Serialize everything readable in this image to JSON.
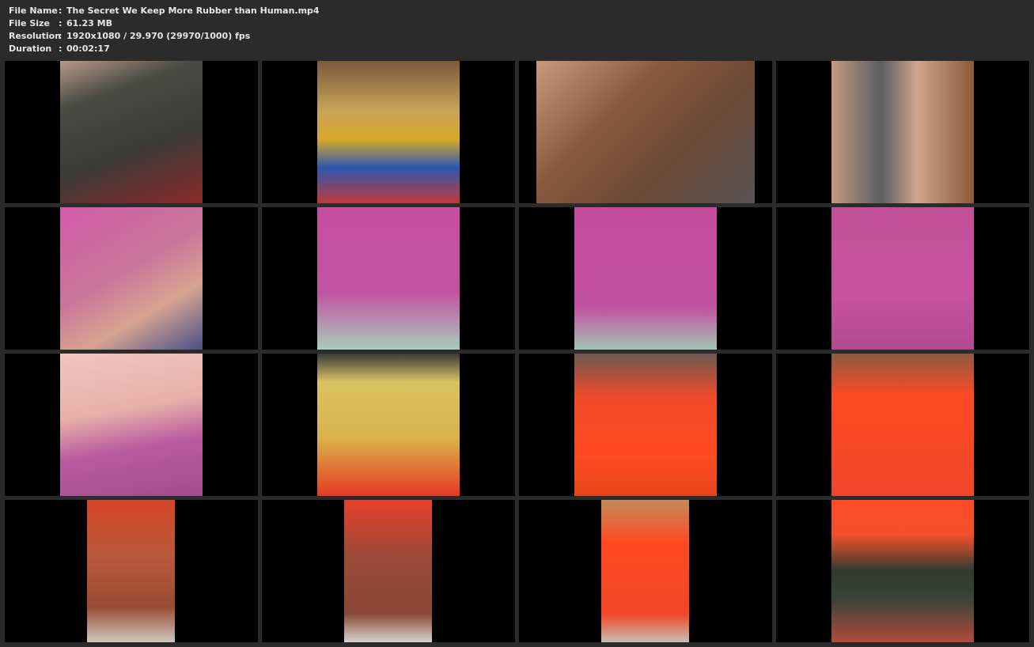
{
  "file_info": {
    "file_name_label": "File Name",
    "file_name_value": "The Secret We Keep More Rubber than Human.mp4",
    "file_size_label": "File Size",
    "file_size_value": "61.23 MB",
    "resolution_label": "Resolution",
    "resolution_value": "1920x1080 / 29.970 (29970/1000) fps",
    "duration_label": "Duration",
    "duration_value": "00:02:17",
    "separator": ":"
  },
  "thumbnail_grid": {
    "columns": 4,
    "rows": 4,
    "cell_background": "#000000",
    "page_background": "#2b2b2b"
  }
}
